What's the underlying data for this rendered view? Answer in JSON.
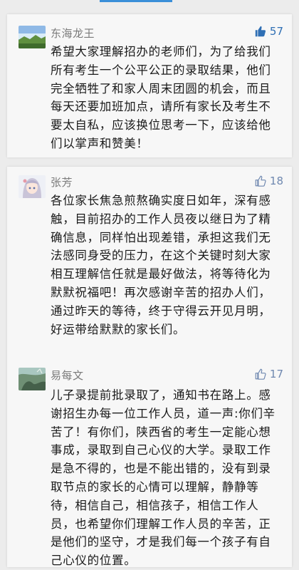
{
  "comments": [
    {
      "username": "东海龙王",
      "likes": "57",
      "text": "希望大家理解招办的老师们，为了给我们所有考生一个公平公正的录取结果，他们完全牺牲了和家人周末团圆的机会，而且每天还要加班加点，请所有家长及考生不要太自私，应该换位思考一下，应该给他们以掌声和赞美！",
      "liked": true
    },
    {
      "username": "张芳",
      "likes": "18",
      "text": "各位家长焦急煎熬确实度日如年，深有感触，目前招办的工作人员夜以继日为了精确信息，同样怕出现差错，承担这我们无法感同身受的压力，在这个关键时刻大家相互理解信任就是最好做法，将等待化为默默祝福吧！再次感谢辛苦的招办人们，通过昨天的等待，终于守得云开见月明，好运带给默默的家长们。",
      "liked": false
    },
    {
      "username": "易每文",
      "likes": "17",
      "text": "儿子录提前批录取了，通知书在路上。感谢招生办每一位工作人员，道一声:你们辛苦了！有你们，陕西省的考生一定能心想事成，录取到自己心仪的大学。录取工作是急不得的，也是不能出错的，没有到录取节点的家长的心情可以理解，静静等待，相信自己，相信孩子，相信工作人员，也希望你们理解工作人员的辛苦，正是他们的坚守，才是我们每一个孩子有自己心仪的位置。",
      "liked": false
    }
  ],
  "colors": {
    "accent_liked": "#2f6fb4",
    "accent_unliked": "#6f88b0",
    "username": "#7a7a7a",
    "text": "#1a1a1a"
  }
}
